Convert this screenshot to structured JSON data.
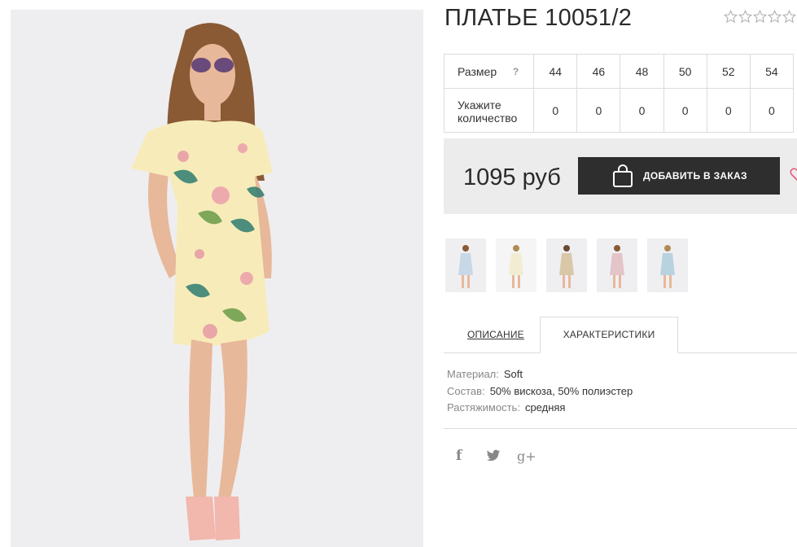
{
  "product": {
    "title": "ПЛАТЬЕ 10051/2",
    "rating_stars": 5,
    "rating_value": 0
  },
  "sizes": {
    "size_label": "Размер",
    "help_icon": "?",
    "qty_label": "Укажите количество",
    "values": [
      "44",
      "46",
      "48",
      "50",
      "52",
      "54"
    ],
    "quantities": [
      "0",
      "0",
      "0",
      "0",
      "0",
      "0"
    ]
  },
  "purchase": {
    "price": "1095 руб",
    "add_button": "ДОБАВИТЬ В ЗАКАЗ",
    "button_color": "#2e2e2e",
    "heart_color": "#e85a7a"
  },
  "thumbnails": [
    {
      "name": "thumb-1",
      "dress_color": "#c9d8e6"
    },
    {
      "name": "thumb-2",
      "dress_color": "#f2ecd2"
    },
    {
      "name": "thumb-3",
      "dress_color": "#d8c8a8"
    },
    {
      "name": "thumb-4",
      "dress_color": "#e3c4c8"
    },
    {
      "name": "thumb-5",
      "dress_color": "#b8d2e0"
    }
  ],
  "tabs": {
    "description": "ОПИСАНИЕ",
    "characteristics": "ХАРАКТЕРИСТИКИ",
    "active": "characteristics"
  },
  "characteristics": [
    {
      "key": "Материал:",
      "value": "Soft"
    },
    {
      "key": "Состав:",
      "value": "50% вискоза, 50% полиэстер"
    },
    {
      "key": "Растяжимость:",
      "value": "средняя"
    }
  ],
  "social": {
    "facebook": "f",
    "google_plus": "g+"
  },
  "colors": {
    "photo_bg": "#eeeef0",
    "dress": "#f7ecb9",
    "price_box_bg": "#ececec"
  }
}
